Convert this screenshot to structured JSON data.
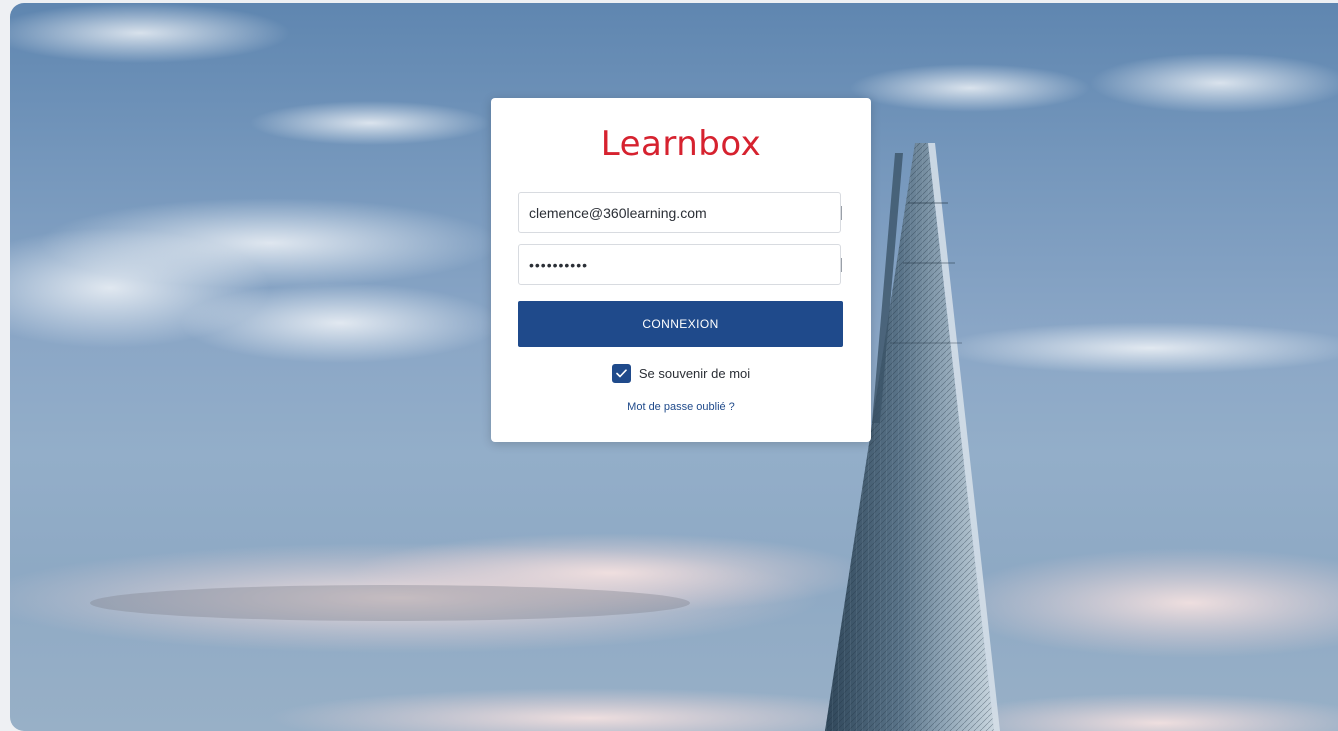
{
  "brand": {
    "name": "Learnbox",
    "color": "#d6222f"
  },
  "login": {
    "email_value": "clemence@360learning.com",
    "password_value": "••••••••••",
    "submit_label": "CONNEXION",
    "remember_label": "Se souvenir de moi",
    "remember_checked": true,
    "forgot_link": "Mot de passe oublié ?"
  },
  "colors": {
    "primary": "#1f4a8b",
    "brand_red": "#d6222f"
  },
  "icons": {
    "checkbox": "checkmark-icon"
  }
}
